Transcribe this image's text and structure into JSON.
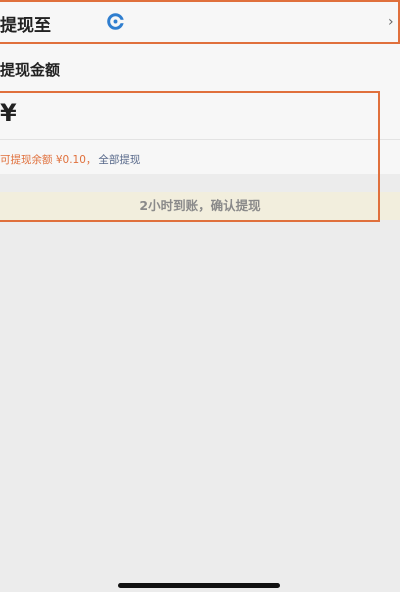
{
  "destination": {
    "label": "提现至",
    "bank_icon": "bank-logo-icon",
    "chevron_icon": "chevron-right-icon",
    "chevron_glyph": "›"
  },
  "amount": {
    "title": "提现金额",
    "currency_symbol": "¥",
    "balance_text": "可提现余额 ¥0.10，",
    "withdraw_all_label": "全部提现"
  },
  "confirm": {
    "label": "2小时到账，确认提现"
  },
  "colors": {
    "highlight": "#e0703c",
    "link": "#57688a",
    "confirm_bg": "#f2eedd"
  }
}
